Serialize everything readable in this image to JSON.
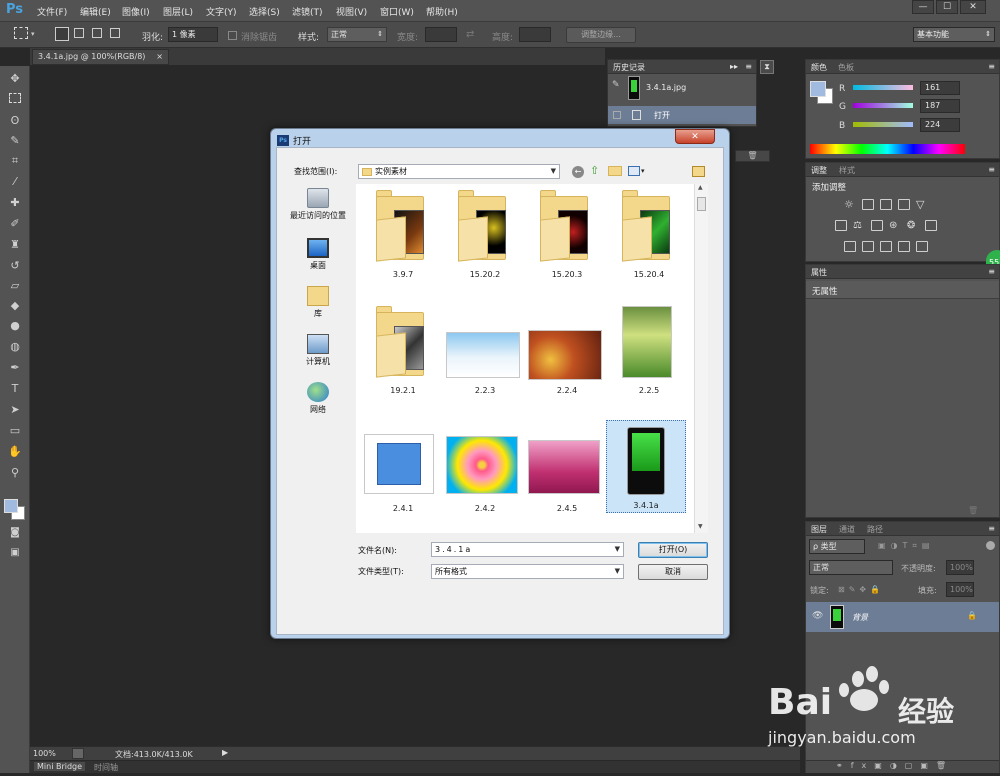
{
  "app": {
    "logo": "Ps"
  },
  "menu": [
    "文件(F)",
    "编辑(E)",
    "图像(I)",
    "图层(L)",
    "文字(Y)",
    "选择(S)",
    "滤镜(T)",
    "视图(V)",
    "窗口(W)",
    "帮助(H)"
  ],
  "window_controls": {
    "minimize": "—",
    "maximize": "☐",
    "close": "✕"
  },
  "options": {
    "feather_label": "羽化:",
    "feather_value": "1 像素",
    "antialias_label": "消除锯齿",
    "style_label": "样式:",
    "style_value": "正常",
    "width_label": "宽度:",
    "height_label": "高度:",
    "refine_button": "调整边缘...",
    "workspace": "基本功能"
  },
  "document_tab": {
    "title": "3.4.1a.jpg @ 100%(RGB/8)",
    "close": "×"
  },
  "history": {
    "tab": "历史记录",
    "snapshot": "3.4.1a.jpg",
    "step": "打开"
  },
  "color_panel": {
    "tabs": [
      "颜色",
      "色板"
    ],
    "channels": [
      {
        "name": "R",
        "value": "161"
      },
      {
        "name": "G",
        "value": "187"
      },
      {
        "name": "B",
        "value": "224"
      }
    ],
    "foreground": "#a1bbe0"
  },
  "adjustments": {
    "tabs": [
      "调整",
      "样式"
    ],
    "title": "添加调整"
  },
  "properties": {
    "tab": "属性",
    "text": "无属性"
  },
  "layers": {
    "tabs": [
      "图层",
      "通道",
      "路径"
    ],
    "filter": "ρ 类型",
    "blend": "正常",
    "opacity_label": "不透明度:",
    "opacity_value": "100%",
    "lock_label": "锁定:",
    "fill_label": "填充:",
    "fill_value": "100%",
    "layer_name": "背景"
  },
  "status": {
    "zoom": "100%",
    "doc": "文档:413.0K/413.0K"
  },
  "bottom_tabs": [
    "Mini Bridge",
    "时间轴"
  ],
  "badge": "55",
  "dialog": {
    "title": "打开",
    "close": "✕",
    "lookin_label": "查找范围(I):",
    "lookin_value": "实例素材",
    "places": [
      "最近访问的位置",
      "桌面",
      "库",
      "计算机",
      "网络"
    ],
    "items": [
      {
        "label": "3.9.7",
        "kind": "folder"
      },
      {
        "label": "15.20.2",
        "kind": "folder"
      },
      {
        "label": "15.20.3",
        "kind": "folder"
      },
      {
        "label": "15.20.4",
        "kind": "folder"
      },
      {
        "label": "19.2.1",
        "kind": "folder"
      },
      {
        "label": "2.2.3",
        "kind": "image"
      },
      {
        "label": "2.2.4",
        "kind": "image"
      },
      {
        "label": "2.2.5",
        "kind": "image"
      },
      {
        "label": "2.4.1",
        "kind": "image"
      },
      {
        "label": "2.4.2",
        "kind": "image"
      },
      {
        "label": "2.4.5",
        "kind": "image"
      },
      {
        "label": "3.4.1a",
        "kind": "image",
        "selected": true
      }
    ],
    "filename_label": "文件名(N):",
    "filename_value": "3.4.1a",
    "filetype_label": "文件类型(T):",
    "filetype_value": "所有格式",
    "open_button": "打开(O)",
    "cancel_button": "取消"
  },
  "watermark": {
    "brand": "Bai",
    "brand_cn": "经验",
    "url": "jingyan.baidu.com"
  }
}
